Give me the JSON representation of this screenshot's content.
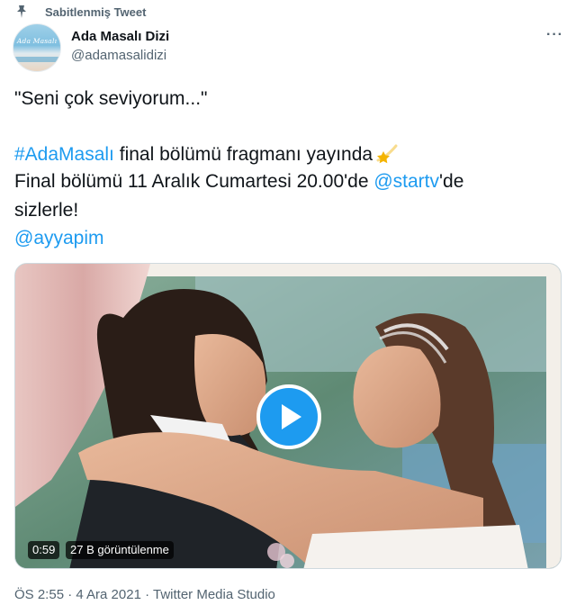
{
  "pinned": {
    "label": "Sabitlenmiş Tweet",
    "icon": "pin-icon"
  },
  "author": {
    "name": "Ada Masalı Dizi",
    "handle": "@adamasalidizi",
    "avatar_text": "Ada Masalı"
  },
  "tweet": {
    "line1": "\"Seni çok seviyorum...\"",
    "hashtag": "#AdaMasalı",
    "line2_rest": " final bölümü fragmanı yayında",
    "emoji": "shooting-star-emoji",
    "line3_start": "Final bölümü 11 Aralık Cumartesi 20.00'de ",
    "mention1": "@startv",
    "line3_end": "'de",
    "line4": "sizlerle!",
    "mention2": "@ayyapim"
  },
  "video": {
    "duration": "0:59",
    "views": "27 B görüntülenme"
  },
  "meta": "ÖS 2:55 · 4 Ara 2021 · Twitter Media Studio",
  "colors": {
    "link": "#1d9bf0",
    "secondary_text": "#536471",
    "play_button": "#1d9bf0"
  }
}
